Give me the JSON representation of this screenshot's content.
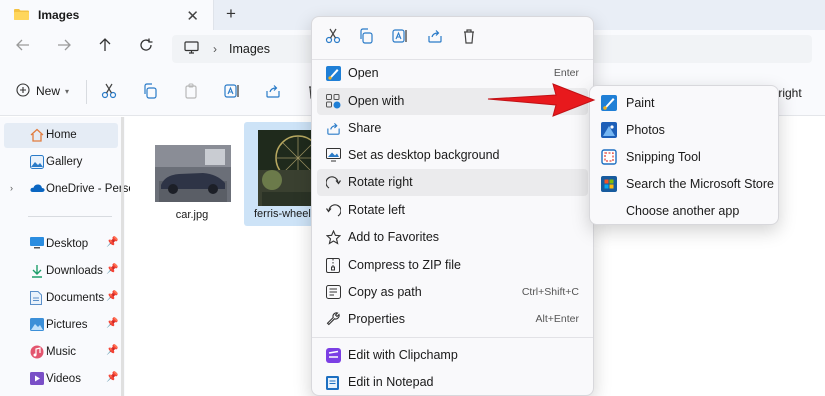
{
  "tab": {
    "title": "Images",
    "close_glyph": "✕",
    "new_glyph": "+"
  },
  "address": {
    "path": "Images",
    "separator": "›"
  },
  "command_bar": {
    "new_label": "New",
    "rotate_right_label": "te right"
  },
  "sidebar": {
    "items": [
      {
        "label": "Home",
        "icon": "home-icon"
      },
      {
        "label": "Gallery",
        "icon": "gallery-icon"
      },
      {
        "label": "OneDrive - Perso",
        "icon": "onedrive-icon"
      },
      {
        "label": "Desktop",
        "icon": "desktop-icon",
        "pinned": true
      },
      {
        "label": "Downloads",
        "icon": "downloads-icon",
        "pinned": true
      },
      {
        "label": "Documents",
        "icon": "documents-icon",
        "pinned": true
      },
      {
        "label": "Pictures",
        "icon": "pictures-icon",
        "pinned": true
      },
      {
        "label": "Music",
        "icon": "music-icon",
        "pinned": true
      },
      {
        "label": "Videos",
        "icon": "videos-icon",
        "pinned": true
      }
    ]
  },
  "files": [
    {
      "name": "car.jpg",
      "selected": false
    },
    {
      "name": "ferris-wheel.j",
      "selected": true
    }
  ],
  "context_menu": {
    "items": [
      {
        "label": "Open",
        "shortcut": "Enter",
        "icon": "paint-icon"
      },
      {
        "label": "Open with",
        "shortcut": "",
        "icon": "open-with-icon",
        "highlighted": true
      },
      {
        "label": "Share",
        "shortcut": "",
        "icon": "share-icon"
      },
      {
        "label": "Set as desktop background",
        "shortcut": "",
        "icon": "desktop-background-icon"
      },
      {
        "label": "Rotate right",
        "shortcut": "",
        "icon": "rotate-right-icon",
        "highlighted": true
      },
      {
        "label": "Rotate left",
        "shortcut": "",
        "icon": "rotate-left-icon"
      },
      {
        "label": "Add to Favorites",
        "shortcut": "",
        "icon": "star-icon"
      },
      {
        "label": "Compress to ZIP file",
        "shortcut": "",
        "icon": "zip-icon"
      },
      {
        "label": "Copy as path",
        "shortcut": "Ctrl+Shift+C",
        "icon": "copy-path-icon"
      },
      {
        "label": "Properties",
        "shortcut": "Alt+Enter",
        "icon": "wrench-icon"
      },
      {
        "label": "Edit with Clipchamp",
        "shortcut": "",
        "icon": "clipchamp-icon"
      },
      {
        "label": "Edit in Notepad",
        "shortcut": "",
        "icon": "notepad-icon"
      }
    ]
  },
  "submenu": {
    "items": [
      {
        "label": "Paint",
        "icon": "paint-icon"
      },
      {
        "label": "Photos",
        "icon": "photos-icon"
      },
      {
        "label": "Snipping Tool",
        "icon": "snipping-tool-icon"
      },
      {
        "label": "Search the Microsoft Store",
        "icon": "microsoft-store-icon"
      },
      {
        "label": "Choose another app",
        "icon": ""
      }
    ]
  },
  "colors": {
    "accent": "#0067c0",
    "annotation_arrow": "#e8191d",
    "folder": "#f4c242",
    "selection": "#cde3f7"
  }
}
